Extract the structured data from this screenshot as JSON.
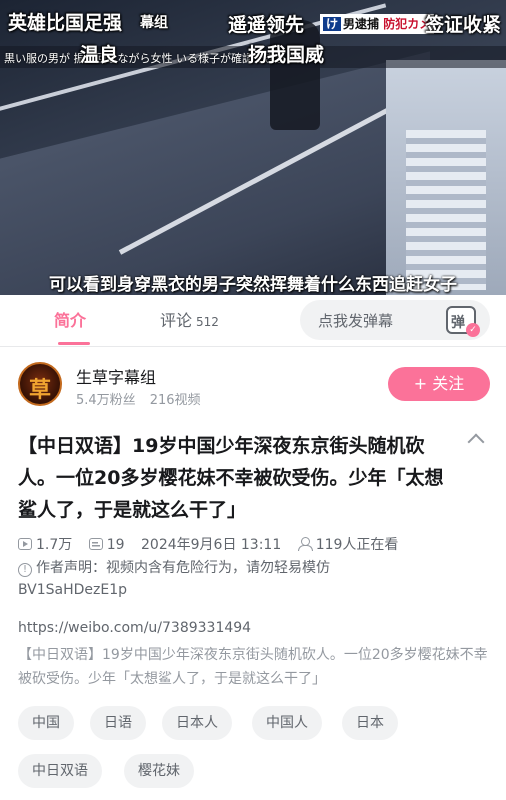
{
  "video": {
    "danmaku": [
      "英雄比国足强",
      "遥遥领先",
      "签证收紧",
      "温良",
      "扬我国威"
    ],
    "overlay_tag": "幕组",
    "japanese_caption": "黒い服の男が 振り回しながら女性 いる様子が確認できます。",
    "news_badge": {
      "prefix": "け",
      "arrest": "男逮捕",
      "camera": "防犯カメ"
    },
    "subtitle": "可以看到身穿黑衣的男子突然挥舞着什么东西追赶女子"
  },
  "tabs": {
    "intro": "简介",
    "comments": "评论",
    "comments_count": "512",
    "danmaku_placeholder": "点我发弹幕",
    "danmaku_button": "弹"
  },
  "uploader": {
    "avatar_glyph": "草",
    "name": "生草字幕组",
    "fans": "5.4万粉丝",
    "videos": "216视频",
    "follow_label": "+ 关注"
  },
  "video_info": {
    "title": "【中日双语】19岁中国少年深夜东京街头随机砍人。一位20多岁樱花妹不幸被砍受伤。少年「太想鲨人了，于是就这么干了」",
    "views": "1.7万",
    "danmaku_count": "19",
    "datetime": "2024年9月6日 13:11",
    "watching": "119人正在看",
    "statement": "作者声明：视频内含有危险行为，请勿轻易模仿",
    "bvid": "BV1SaHDezE1p",
    "link": "https://weibo.com/u/7389331494",
    "description": "【中日双语】19岁中国少年深夜东京街头随机砍人。一位20多岁樱花妹不幸被砍受伤。少年「太想鲨人了，于是就这么干了」"
  },
  "tags": [
    "中国",
    "日语",
    "日本人",
    "中国人",
    "日本",
    "中日双语",
    "樱花妹"
  ],
  "colors": {
    "accent": "#fb7299",
    "text_primary": "#18191c",
    "text_secondary": "#61666d",
    "text_muted": "#9499a0",
    "chip_bg": "#f1f2f3"
  }
}
